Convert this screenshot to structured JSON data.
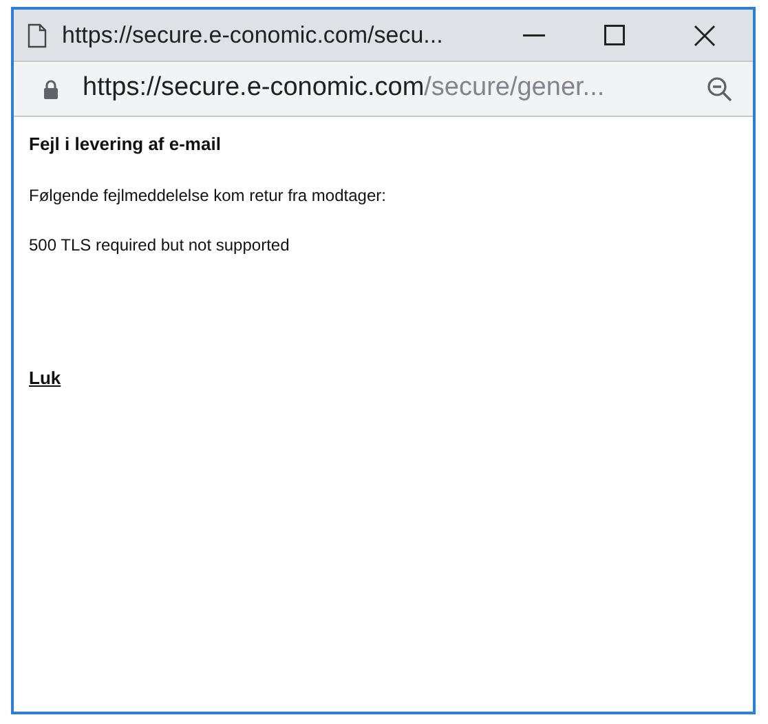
{
  "window": {
    "title": "https://secure.e-conomic.com/secu..."
  },
  "address_bar": {
    "host": "https://secure.e-conomic.com",
    "path": "/secure/gener..."
  },
  "content": {
    "heading": "Fejl i levering af e-mail",
    "paragraphs": [
      "Følgende fejlmeddelelse kom retur fra modtager:",
      "500 TLS required but not supported"
    ],
    "link": "Luk"
  }
}
